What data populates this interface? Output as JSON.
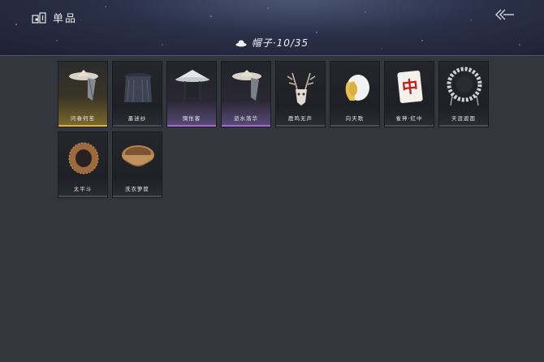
{
  "header": {
    "title": "单品"
  },
  "category": {
    "label": "帽子·10/35"
  },
  "items": [
    {
      "name": "问春何苦"
    },
    {
      "name": "墨迷纱"
    },
    {
      "name": "惆怅客"
    },
    {
      "name": "逝水落华"
    },
    {
      "name": "鹿鸣无声"
    },
    {
      "name": "向天歌"
    },
    {
      "name": "雀神·红中"
    },
    {
      "name": "天涯遮面"
    },
    {
      "name": "太平斗"
    },
    {
      "name": "洗衣箩筐"
    }
  ]
}
